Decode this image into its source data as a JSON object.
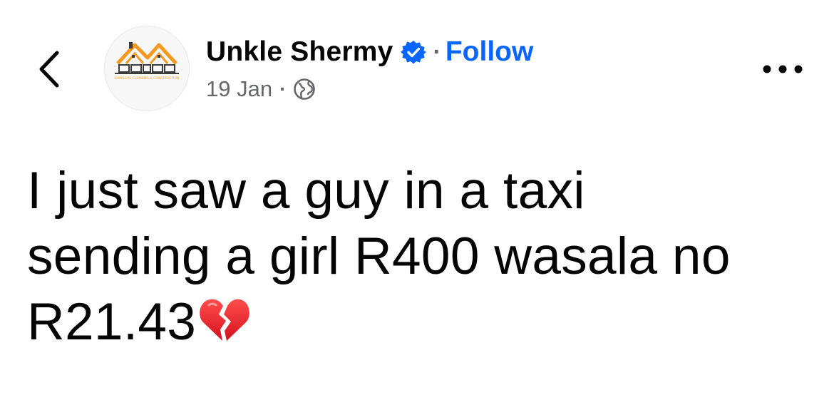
{
  "header": {
    "author_name": "Unkle Shermy",
    "follow_label": "Follow",
    "separator": "·",
    "date": "19 Jan",
    "privacy_icon": "globe-icon",
    "verified_icon": "verified-badge-icon",
    "back_icon": "chevron-left-icon",
    "more_icon": "more-options-icon",
    "avatar_logo_text": "SHAKELAS CLEANING & CONSTRUCTION"
  },
  "post": {
    "lines": [
      "I just saw a guy in a taxi",
      "sending a girl R400 wasala no",
      "R21.43"
    ],
    "emoji": "broken-heart-icon"
  },
  "colors": {
    "link": "#0866ff",
    "meta": "#65676b",
    "text": "#050505",
    "verified": "#0866ff",
    "logo_orange": "#f39a1e",
    "heart_red": "#e8202a"
  }
}
